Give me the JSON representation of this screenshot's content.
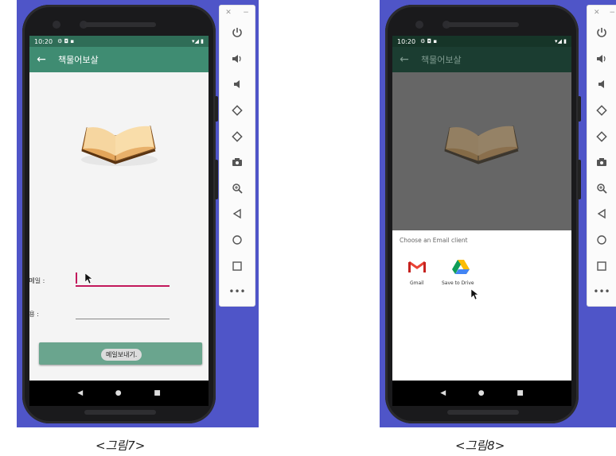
{
  "left_screen": {
    "status_time": "10:20",
    "title": "책물어보살",
    "email_label": "이메일 :",
    "content_label": "내용 :",
    "send_button": "메일보내기."
  },
  "right_screen": {
    "status_time": "10:20",
    "title": "책물어보살",
    "chooser_title": "Choose an Email client",
    "apps": [
      {
        "label": "Gmail",
        "icon": "gmail-icon"
      },
      {
        "label": "Save to Drive",
        "icon": "google-drive-icon"
      }
    ]
  },
  "captions": [
    "<그림7>",
    "<그림8>"
  ],
  "emulator_toolbar": [
    "power-icon",
    "volume-up-icon",
    "volume-down-icon",
    "rotate-left-icon",
    "rotate-right-icon",
    "camera-icon",
    "zoom-icon",
    "back-icon",
    "home-icon",
    "overview-icon",
    "more-icon"
  ],
  "colors": {
    "background": "#4f55c8",
    "appbar": "#3f8c72",
    "appbar_dimmed": "#1b3d31",
    "accent": "#c2185b",
    "button": "#6aa58e"
  }
}
